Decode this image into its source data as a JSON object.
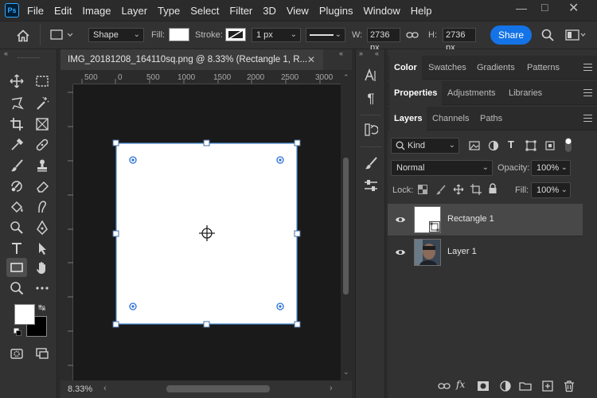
{
  "app": {
    "logo_text": "Ps"
  },
  "menu": [
    "File",
    "Edit",
    "Image",
    "Layer",
    "Type",
    "Select",
    "Filter",
    "3D",
    "View",
    "Plugins",
    "Window",
    "Help"
  ],
  "options_bar": {
    "mode_value": "Shape",
    "fill_label": "Fill:",
    "stroke_label": "Stroke:",
    "stroke_width": "1 px",
    "w_label": "W:",
    "w_value": "2736 px",
    "h_label": "H:",
    "h_value": "2736 px",
    "share_label": "Share"
  },
  "document": {
    "tab_title": "IMG_20181208_164110sq.png @ 8.33% (Rectangle 1, R...",
    "zoom": "8.33%",
    "ruler_labels": [
      "500",
      "0",
      "500",
      "1000",
      "1500",
      "2000",
      "2500",
      "3000"
    ]
  },
  "panels": {
    "group1_tabs": [
      "Color",
      "Swatches",
      "Gradients",
      "Patterns"
    ],
    "group2_tabs": [
      "Properties",
      "Adjustments",
      "Libraries"
    ],
    "group3_tabs": [
      "Layers",
      "Channels",
      "Paths"
    ],
    "kind_filter": "Kind",
    "blend_mode": "Normal",
    "opacity_label": "Opacity:",
    "opacity_value": "100%",
    "lock_label": "Lock:",
    "fill_label": "Fill:",
    "fill_value": "100%",
    "layers": [
      {
        "name": "Rectangle 1",
        "selected": true
      },
      {
        "name": "Layer 1",
        "selected": false
      }
    ]
  },
  "colors": {
    "accent": "#1473e6",
    "selection": "#4a90d9",
    "canvas_bg": "#1a1a1a",
    "panel_bg": "#323232"
  }
}
